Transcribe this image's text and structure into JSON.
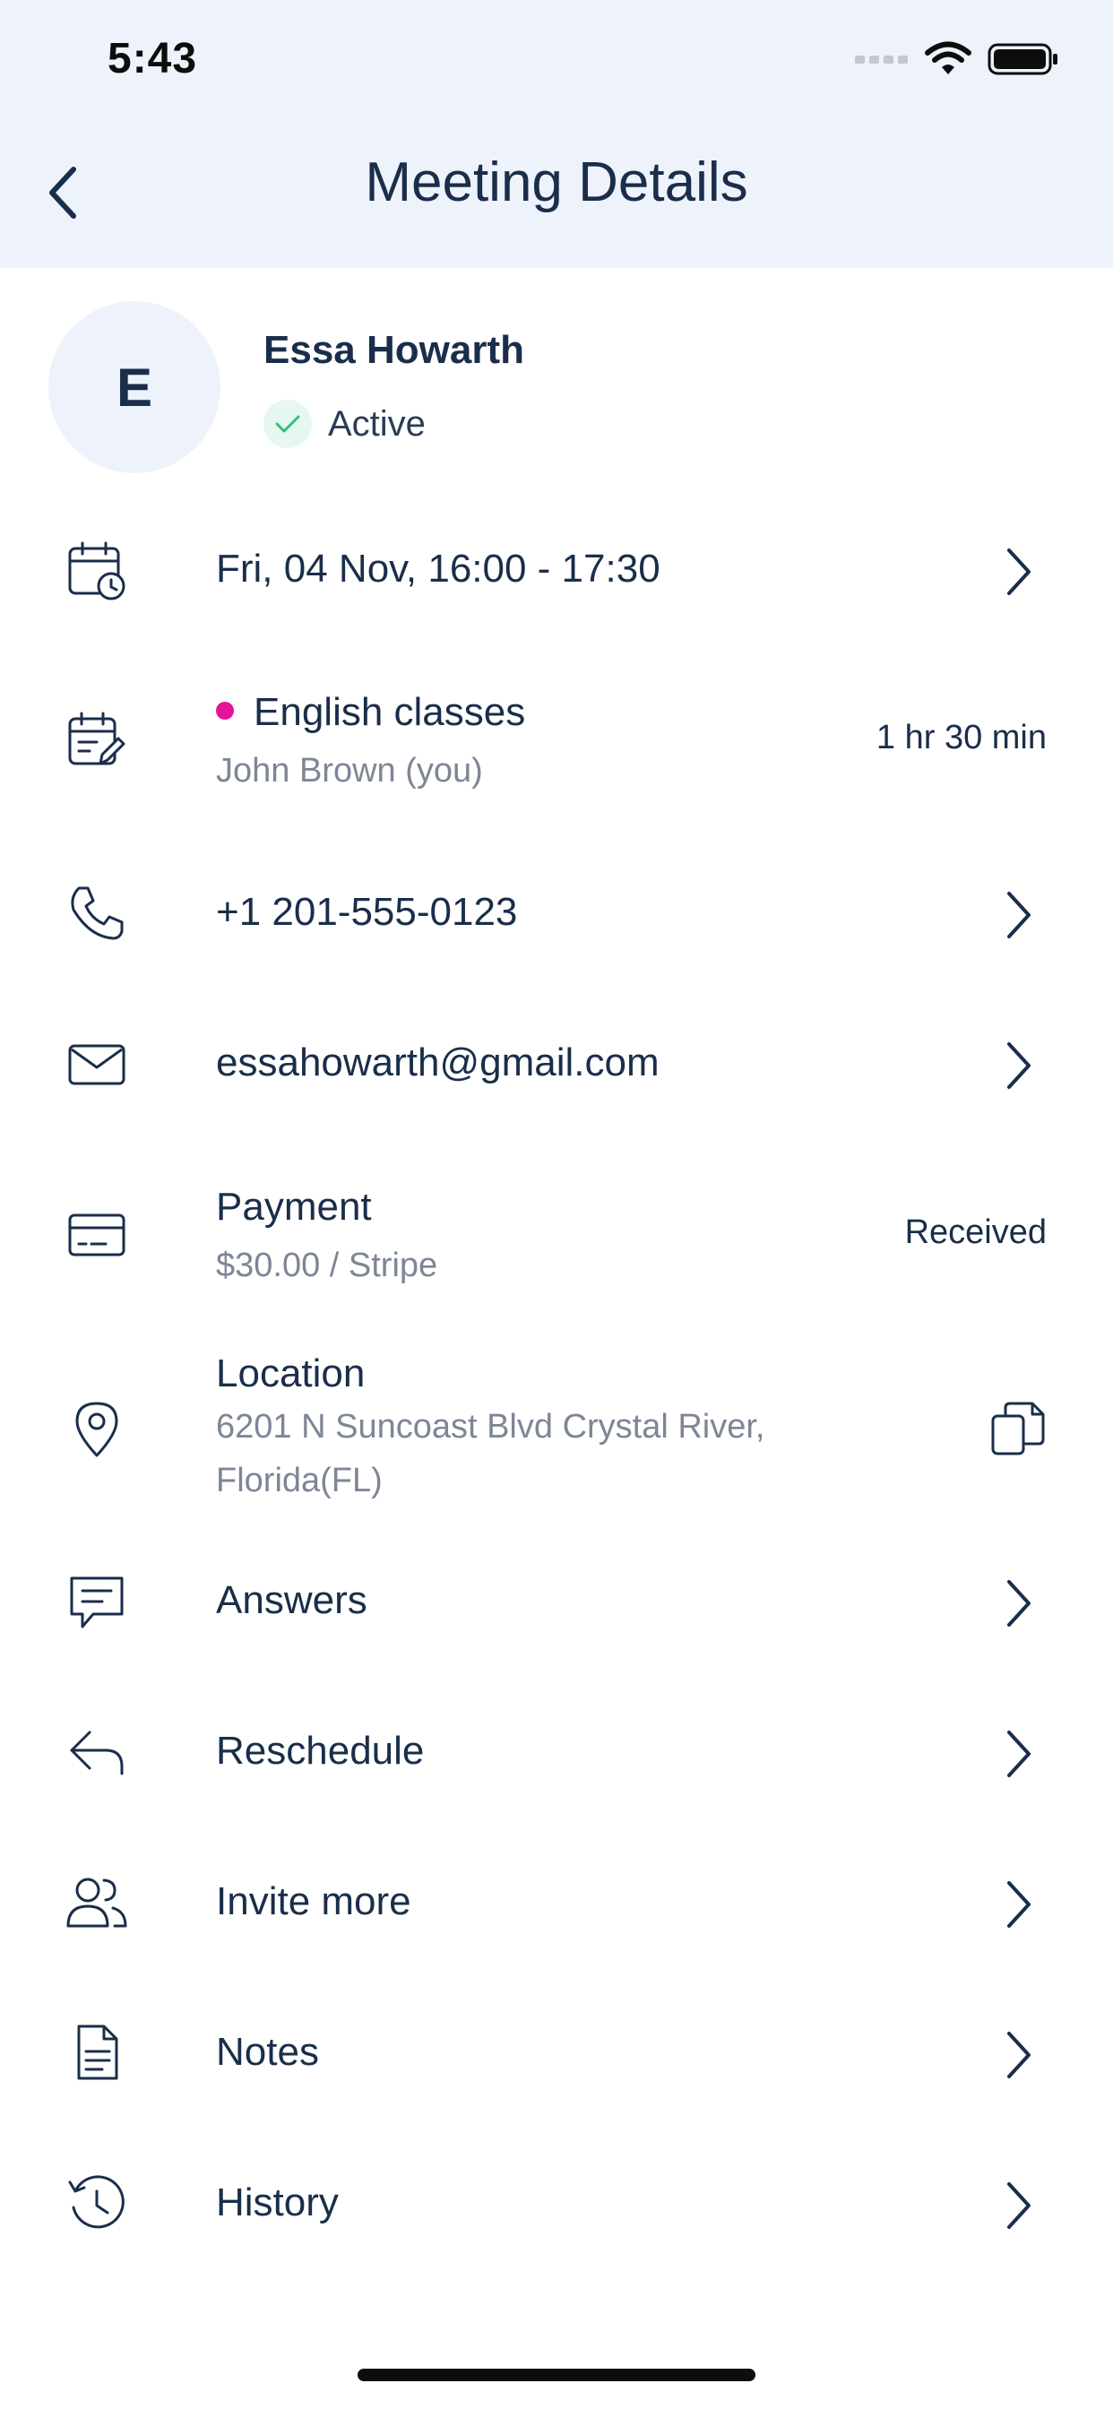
{
  "status_bar": {
    "time": "5:43"
  },
  "header": {
    "title": "Meeting Details"
  },
  "profile": {
    "initial": "E",
    "name": "Essa Howarth",
    "status": "Active"
  },
  "rows": {
    "datetime": {
      "text": "Fri, 04 Nov, 16:00 - 17:30"
    },
    "event": {
      "title": "English classes",
      "subtitle": "John Brown (you)",
      "duration": "1 hr 30 min",
      "dot_color": "#e6139a"
    },
    "phone": {
      "text": "+1 201-555-0123"
    },
    "email": {
      "text": "essahowarth@gmail.com"
    },
    "payment": {
      "title": "Payment",
      "subtitle": "$30.00 / Stripe",
      "status": "Received"
    },
    "location": {
      "title": "Location",
      "address_line1": "6201 N Suncoast Blvd Crystal River,",
      "address_line2": "Florida(FL)"
    },
    "answers": {
      "text": "Answers"
    },
    "reschedule": {
      "text": "Reschedule"
    },
    "invite": {
      "text": "Invite more"
    },
    "notes": {
      "text": "Notes"
    },
    "history": {
      "text": "History"
    }
  },
  "colors": {
    "header_bg": "#eef2fb",
    "text_primary": "#1a2e4a",
    "text_secondary": "#7d8696",
    "accent_dot": "#e6139a",
    "active_check": "#2fbf7a"
  }
}
